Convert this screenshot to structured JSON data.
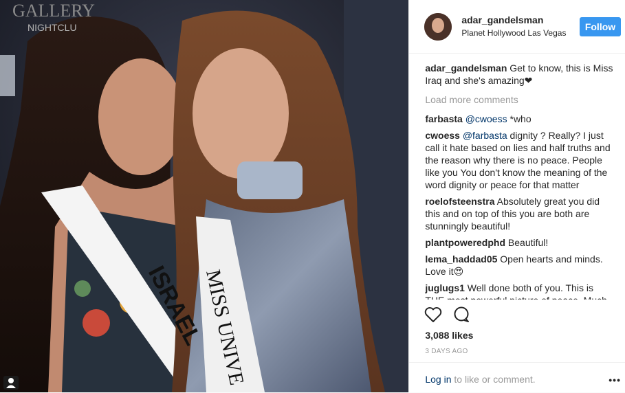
{
  "header": {
    "username": "adar_gandelsman",
    "location": "Planet Hollywood Las Vegas",
    "follow_label": "Follow"
  },
  "photo": {
    "sign_text": "GALLERY",
    "sign_subtext": "NIGHTCLU",
    "sash_left": "ISRAEL",
    "sash_right": "MISS UNIVE"
  },
  "caption": {
    "user": "adar_gandelsman",
    "text": "Get to know, this is Miss Iraq and she's amazing❤"
  },
  "load_more": "Load more comments",
  "comments": [
    {
      "user": "farbasta",
      "mention": "@cwoess",
      "text": "*who"
    },
    {
      "user": "cwoess",
      "mention": "@farbasta",
      "text": "dignity ? Really? I just call it hate based on lies and half truths and the reason why there is no peace. People like you You don't know the meaning of the word dignity or peace for that matter"
    },
    {
      "user": "roelofsteenstra",
      "mention": "",
      "text": "Absolutely great you did this and on top of this you are both are stunningly beautiful!"
    },
    {
      "user": "plantpoweredphd",
      "mention": "",
      "text": "Beautiful!"
    },
    {
      "user": "lema_haddad05",
      "mention": "",
      "text": "Open hearts and minds. Love it😍"
    },
    {
      "user": "juglugs1",
      "mention": "",
      "text": "Well done both of you. This is THE most powerful picture of peace. Much"
    }
  ],
  "likes": "3,088 likes",
  "time": "3 DAYS AGO",
  "footer": {
    "login_link": "Log in",
    "login_rest": " to like or comment.",
    "more_label": "•••"
  },
  "icons": [
    "heart-icon",
    "comment-icon",
    "user-icon"
  ]
}
